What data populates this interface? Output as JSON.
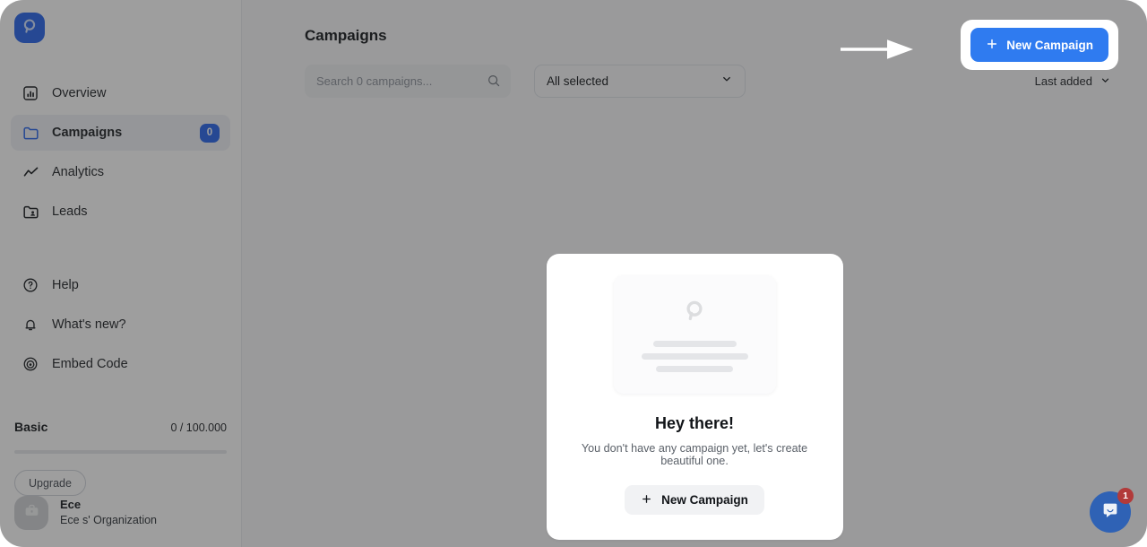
{
  "brand": {
    "logo_icon": "paperbell-logo-icon",
    "accent_color": "#2563eb",
    "primary_button_color": "#2f7bf0"
  },
  "sidebar": {
    "primary_items": [
      {
        "label": "Overview",
        "icon": "bar-chart-icon",
        "active": false,
        "badge": null
      },
      {
        "label": "Campaigns",
        "icon": "folder-icon",
        "active": true,
        "badge": "0"
      },
      {
        "label": "Analytics",
        "icon": "trend-line-icon",
        "active": false,
        "badge": null
      },
      {
        "label": "Leads",
        "icon": "leads-folder-icon",
        "active": false,
        "badge": null
      }
    ],
    "secondary_items": [
      {
        "label": "Help",
        "icon": "question-circle-icon"
      },
      {
        "label": "What's new?",
        "icon": "bell-icon"
      },
      {
        "label": "Embed Code",
        "icon": "broadcast-icon"
      }
    ],
    "plan": {
      "name": "Basic",
      "quota": "0 / 100.000",
      "progress_percent": 0,
      "upgrade_label": "Upgrade"
    },
    "user": {
      "name": "Ece",
      "organization": "Ece s' Organization",
      "avatar_icon": "briefcase-icon"
    }
  },
  "header": {
    "title": "Campaigns",
    "new_campaign_label": "New Campaign",
    "new_campaign_icon": "plus-icon"
  },
  "toolbar": {
    "search_placeholder": "Search 0 campaigns...",
    "search_value": "",
    "search_icon": "search-icon",
    "filter_selected": "All selected",
    "filter_chevron_icon": "chevron-down-icon",
    "sort_label": "Last added",
    "sort_chevron_icon": "chevron-down-icon"
  },
  "empty_state": {
    "illustration_icon": "paperbell-logo-placeholder-icon",
    "title": "Hey there!",
    "subtitle": "You don't have any campaign yet, let's create beautiful one.",
    "button_label": "New Campaign",
    "button_icon": "plus-icon"
  },
  "annotation": {
    "arrow_icon": "right-arrow-annotation-icon",
    "arrow_color": "#ffffff"
  },
  "chat": {
    "icon": "chat-bubble-icon",
    "unread_count": "1",
    "bubble_color": "#2f62b5",
    "badge_color": "#b23a3a"
  }
}
